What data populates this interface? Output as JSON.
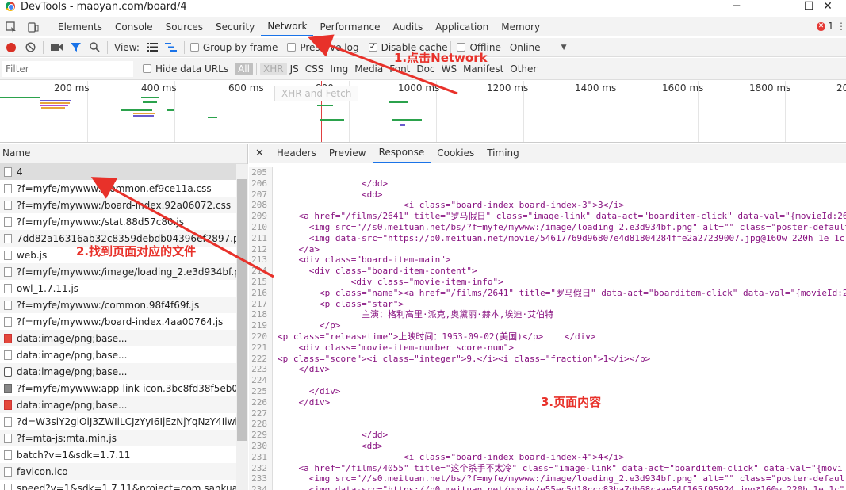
{
  "window": {
    "title": "DevTools - maoyan.com/board/4",
    "minimize": "─",
    "maximize": "☐",
    "close": "✕"
  },
  "tabs": [
    "Elements",
    "Console",
    "Sources",
    "Security",
    "Network",
    "Performance",
    "Audits",
    "Application",
    "Memory"
  ],
  "active_tab": "Network",
  "error_count": "1",
  "toolbar": {
    "view_label": "View:",
    "group_by_frame": "Group by frame",
    "preserve_log": "Preserve log",
    "disable_cache": "Disable cache",
    "offline": "Offline",
    "throttle": "Online"
  },
  "filter": {
    "placeholder": "Filter",
    "hide_data_urls": "Hide data URLs",
    "types": [
      "All",
      "XHR",
      "JS",
      "CSS",
      "Img",
      "Media",
      "Font",
      "Doc",
      "WS",
      "Manifest",
      "Other"
    ]
  },
  "timeline": {
    "ticks": [
      "200 ms",
      "400 ms",
      "600 ms",
      "800 ms",
      "1000 ms",
      "1200 ms",
      "1400 ms",
      "1600 ms",
      "1800 ms",
      "20"
    ],
    "tooltip": "XHR and Fetch"
  },
  "requests": {
    "header": "Name",
    "rows": [
      "4",
      "?f=myfe/mywww:/common.ef9ce11a.css",
      "?f=myfe/mywww:/board-index.92a06072.css",
      "?f=myfe/mywww:/stat.88d57c80.js",
      "7dd82a16316ab32c8359debdb04396ef2897.png",
      "web.js",
      "?f=myfe/mywww:/image/loading_2.e3d934bf.png",
      "owl_1.7.11.js",
      "?f=myfe/mywww:/common.98f4f69f.js",
      "?f=myfe/mywww:/board-index.4aa00764.js",
      "data:image/png;base...",
      "data:image/png;base...",
      "data:image/png;base...",
      "?f=myfe/mywww:app-link-icon.3bc8fd38f5eb0cfcf99",
      "data:image/png;base...",
      "?d=W3siY2giOiJ3ZWIiLCJzYyI6IjEzNjYqNzY4IiwidXVp",
      "?f=mta-js:mta.min.js",
      "batch?v=1&sdk=1.7.11",
      "favicon.ico",
      "speed?v=1&sdk=1.7.11&project=com.sankuai.movie"
    ]
  },
  "detail_tabs": [
    "Headers",
    "Preview",
    "Response",
    "Cookies",
    "Timing"
  ],
  "active_detail_tab": "Response",
  "code_lines": [
    {
      "n": "205",
      "t": ""
    },
    {
      "n": "206",
      "t": "                </dd>"
    },
    {
      "n": "207",
      "t": "                <dd>"
    },
    {
      "n": "208",
      "t": "                        <i class=\"board-index board-index-3\">3</i>"
    },
    {
      "n": "209",
      "t": "    <a href=\"/films/2641\" title=\"罗马假日\" class=\"image-link\" data-act=\"boarditem-click\" data-val=\"{movieId:26"
    },
    {
      "n": "210",
      "t": "      <img src=\"//s0.meituan.net/bs/?f=myfe/mywww:/image/loading_2.e3d934bf.png\" alt=\"\" class=\"poster-default"
    },
    {
      "n": "211",
      "t": "      <img data-src=\"https://p0.meituan.net/movie/54617769d96807e4d81804284ffe2a27239007.jpg@160w_220h_1e_1c\""
    },
    {
      "n": "212",
      "t": "    </a>"
    },
    {
      "n": "213",
      "t": "    <div class=\"board-item-main\">"
    },
    {
      "n": "214",
      "t": "      <div class=\"board-item-content\">"
    },
    {
      "n": "215",
      "t": "              <div class=\"movie-item-info\">"
    },
    {
      "n": "216",
      "t": "        <p class=\"name\"><a href=\"/films/2641\" title=\"罗马假日\" data-act=\"boarditem-click\" data-val=\"{movieId:2"
    },
    {
      "n": "217",
      "t": "        <p class=\"star\">"
    },
    {
      "n": "218",
      "t": "                主演：格利高里·派克,奥黛丽·赫本,埃迪·艾伯特"
    },
    {
      "n": "219",
      "t": "        </p>"
    },
    {
      "n": "220",
      "t": "<p class=\"releasetime\">上映时间：1953-09-02(美国)</p>    </div>"
    },
    {
      "n": "221",
      "t": "    <div class=\"movie-item-number score-num\">"
    },
    {
      "n": "222",
      "t": "<p class=\"score\"><i class=\"integer\">9.</i><i class=\"fraction\">1</i></p>"
    },
    {
      "n": "223",
      "t": "    </div>"
    },
    {
      "n": "224",
      "t": ""
    },
    {
      "n": "225",
      "t": "      </div>"
    },
    {
      "n": "226",
      "t": "    </div>"
    },
    {
      "n": "227",
      "t": ""
    },
    {
      "n": "228",
      "t": ""
    },
    {
      "n": "229",
      "t": "                </dd>"
    },
    {
      "n": "230",
      "t": "                <dd>"
    },
    {
      "n": "231",
      "t": "                        <i class=\"board-index board-index-4\">4</i>"
    },
    {
      "n": "232",
      "t": "    <a href=\"/films/4055\" title=\"这个杀手不太冷\" class=\"image-link\" data-act=\"boarditem-click\" data-val=\"{movi"
    },
    {
      "n": "233",
      "t": "      <img src=\"//s0.meituan.net/bs/?f=myfe/mywww:/image/loading_2.e3d934bf.png\" alt=\"\" class=\"poster-default"
    },
    {
      "n": "234",
      "t": "      <img data-src=\"https://p0.meituan.net/movie/e55ec5d18ccc83ba7db68caae54f165f95924.jpg@160w_220h_1e_1c\""
    }
  ],
  "annotations": {
    "step1": "1.点击Network",
    "step2": "2.找到页面对应的文件",
    "step3": "3.页面内容"
  },
  "colors": {
    "accent": "#1a73e8",
    "annotation": "#e8312a",
    "record": "#d93025"
  }
}
